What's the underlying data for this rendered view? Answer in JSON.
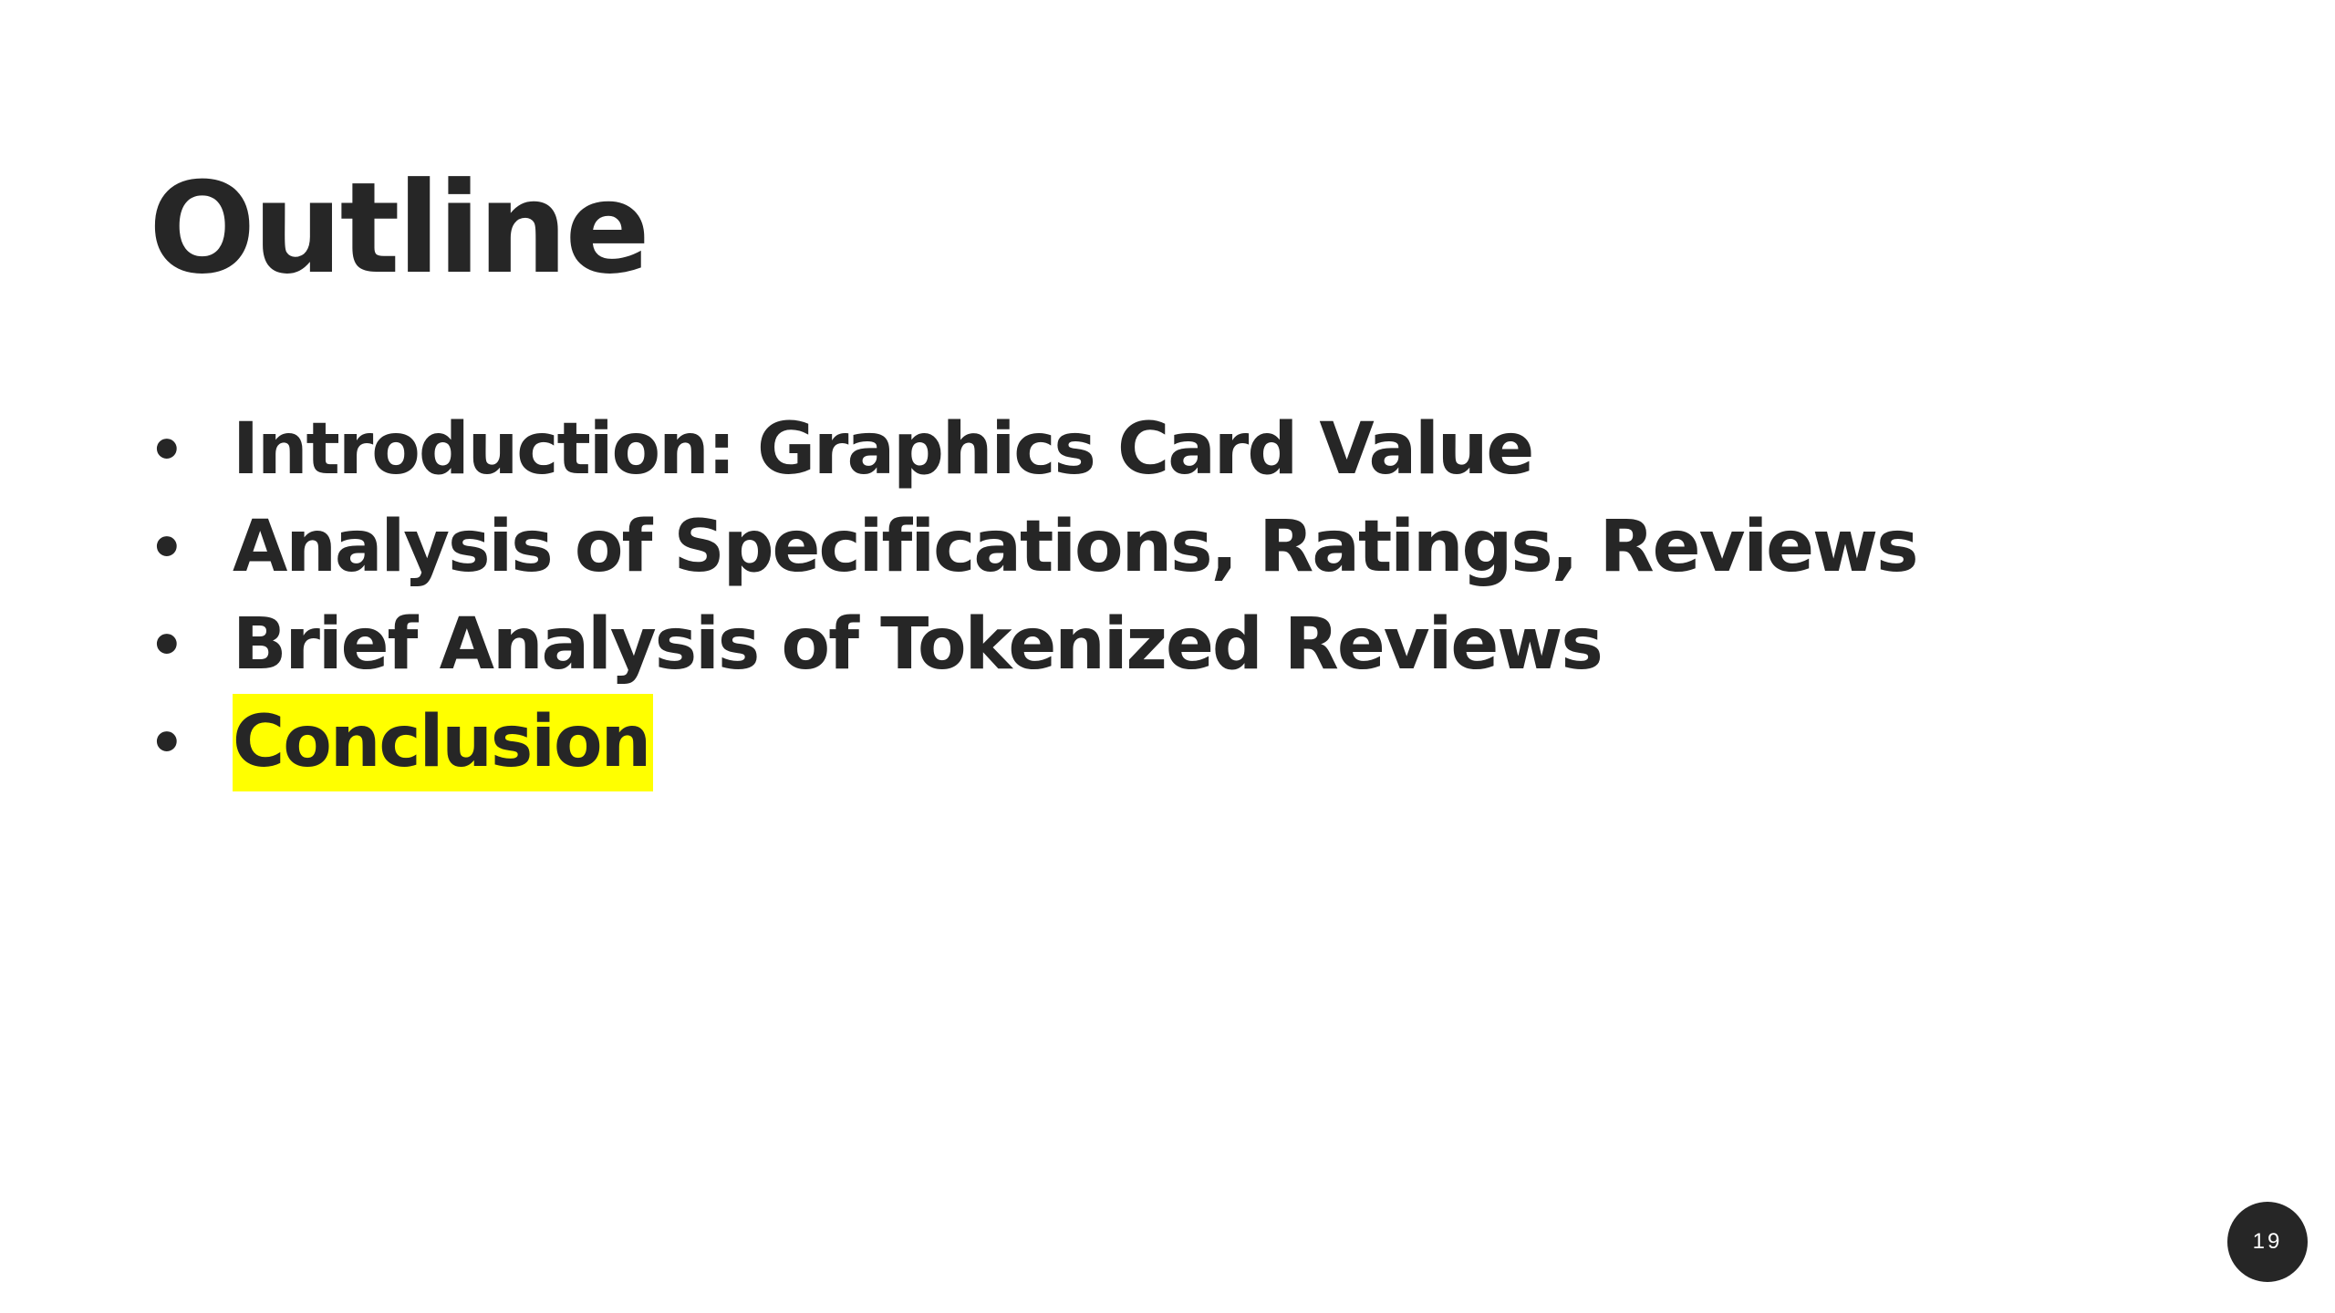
{
  "slide": {
    "title": "Outline",
    "items": [
      {
        "bullet": "•",
        "label": "Introduction: Graphics Card Value",
        "highlighted": false
      },
      {
        "bullet": "•",
        "label": "Analysis of Specifications, Ratings, Reviews",
        "highlighted": false
      },
      {
        "bullet": "•",
        "label": "Brief Analysis of Tokenized Reviews",
        "highlighted": false
      },
      {
        "bullet": "•",
        "label": "Conclusion",
        "highlighted": true
      }
    ],
    "page_number": "19"
  },
  "colors": {
    "text": "#262626",
    "highlight": "#ffff00",
    "badge_background": "#262626",
    "badge_text": "#ffffff",
    "background": "#ffffff"
  }
}
